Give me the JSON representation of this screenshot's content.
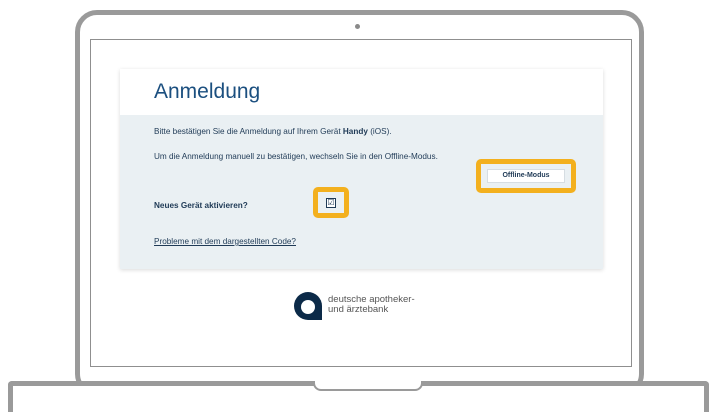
{
  "login": {
    "title": "Anmeldung",
    "confirm_prefix": "Bitte bestätigen Sie die Anmeldung auf Ihrem Gerät ",
    "device_name": "Handy",
    "confirm_suffix": " (iOS).",
    "manual_text": "Um die Anmeldung manuell zu bestätigen, wechseln Sie in den Offline-Modus.",
    "offline_button": "Offline-Modus",
    "new_device_label": "Neues Gerät aktivieren?",
    "checkbox_mark": "☑",
    "problem_link": "Probleme mit dem dargestellten Code?"
  },
  "brand": {
    "line1": "deutsche apotheker-",
    "line2": "und ärztebank",
    "color": "#0c2a48"
  },
  "colors": {
    "title": "#1b4f7f",
    "highlight": "#f3b01e",
    "card_background": "#eaf0f3"
  }
}
